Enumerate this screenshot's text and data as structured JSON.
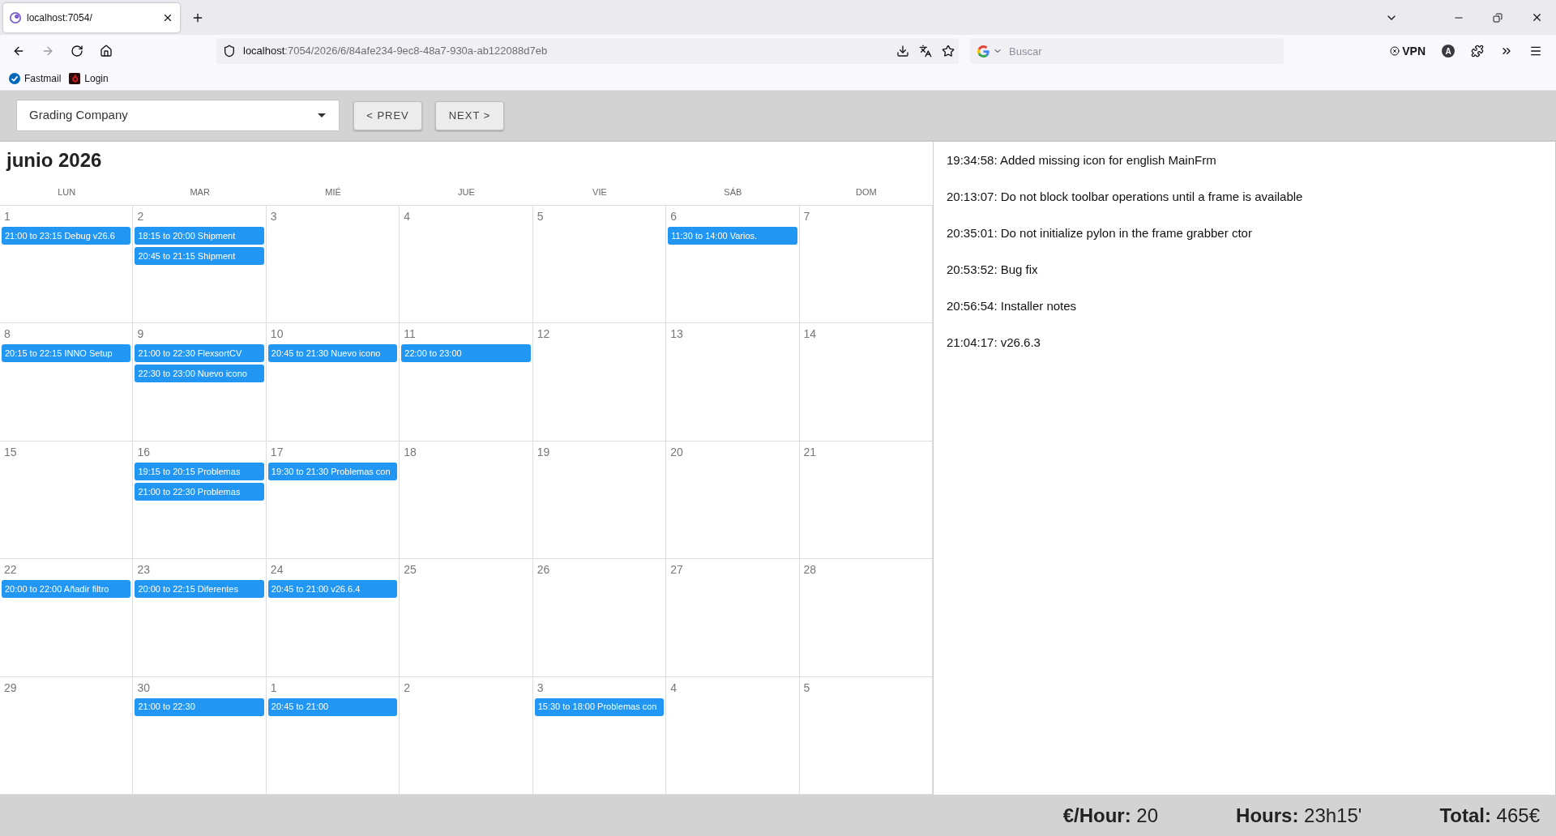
{
  "browser": {
    "tabs": [
      {
        "title": "localhost:7054/",
        "selected": true
      }
    ],
    "address": {
      "host": "localhost",
      "path": ":7054/2026/6/84afe234-9ec8-48a7-930a-ab122088d7eb"
    },
    "search": {
      "placeholder": "Buscar"
    },
    "vpn": {
      "label": "VPN"
    },
    "profile": {
      "initial": "A"
    },
    "bookmarks": [
      {
        "label": "Fastmail",
        "kind": "mail"
      },
      {
        "label": "Login",
        "kind": "square"
      }
    ]
  },
  "toolbar": {
    "company_select": {
      "value": "Grading Company"
    },
    "buttons": [
      "< PREV",
      "NEXT >"
    ]
  },
  "calendar": {
    "title": "junio 2026",
    "weekdays": [
      "LUN",
      "MAR",
      "MIÉ",
      "JUE",
      "VIE",
      "SÁB",
      "DOM"
    ],
    "weeks": [
      [
        {
          "day": "1",
          "events": [
            "21:00 to 23:15 Debug v26.6"
          ]
        },
        {
          "day": "2",
          "events": [
            "18:15 to 20:00 Shipment",
            "20:45 to 21:15 Shipment"
          ]
        },
        {
          "day": "3"
        },
        {
          "day": "4"
        },
        {
          "day": "5"
        },
        {
          "day": "6",
          "events": [
            "11:30 to 14:00 Varios."
          ]
        },
        {
          "day": "7"
        }
      ],
      [
        {
          "day": "8",
          "events": [
            "20:15 to 22:15 INNO Setup"
          ]
        },
        {
          "day": "9",
          "events": [
            "21:00 to 22:30 FlexsortCV",
            "22:30 to 23:00 Nuevo icono"
          ]
        },
        {
          "day": "10",
          "events": [
            "20:45 to 21:30 Nuevo icono"
          ]
        },
        {
          "day": "11",
          "events": [
            "22:00 to 23:00"
          ]
        },
        {
          "day": "12"
        },
        {
          "day": "13"
        },
        {
          "day": "14"
        }
      ],
      [
        {
          "day": "15"
        },
        {
          "day": "16",
          "events": [
            "19:15 to 20:15 Problemas",
            "21:00 to 22:30 Problemas"
          ]
        },
        {
          "day": "17",
          "events": [
            "19:30 to 21:30 Problemas con"
          ]
        },
        {
          "day": "18"
        },
        {
          "day": "19"
        },
        {
          "day": "20"
        },
        {
          "day": "21"
        }
      ],
      [
        {
          "day": "22",
          "events": [
            "20:00 to 22:00 Añadir filtro"
          ]
        },
        {
          "day": "23",
          "events": [
            "20:00 to 22:15 Diferentes"
          ]
        },
        {
          "day": "24",
          "events": [
            "20:45 to 21:00 v26.6.4"
          ]
        },
        {
          "day": "25"
        },
        {
          "day": "26"
        },
        {
          "day": "27"
        },
        {
          "day": "28"
        }
      ],
      [
        {
          "day": "29"
        },
        {
          "day": "30",
          "events": [
            "21:00 to 22:30"
          ]
        },
        {
          "day": "1",
          "events": [
            "20:45 to 21:00"
          ]
        },
        {
          "day": "2"
        },
        {
          "day": "3",
          "events": [
            "15:30 to 18:00 Problemas con"
          ]
        },
        {
          "day": "4"
        },
        {
          "day": "5"
        }
      ]
    ]
  },
  "log": {
    "entries": [
      "19:34:58: Added missing icon for english MainFrm",
      "20:13:07: Do not block toolbar operations until a frame is available",
      "20:35:01: Do not initialize pylon in the frame grabber ctor",
      "20:53:52: Bug fix",
      "20:56:54: Installer notes",
      "21:04:17: v26.6.3"
    ]
  },
  "summary": [
    "**€/Hour:** 20",
    "**Hours:** 23h15'",
    "**Total:** 465€"
  ]
}
